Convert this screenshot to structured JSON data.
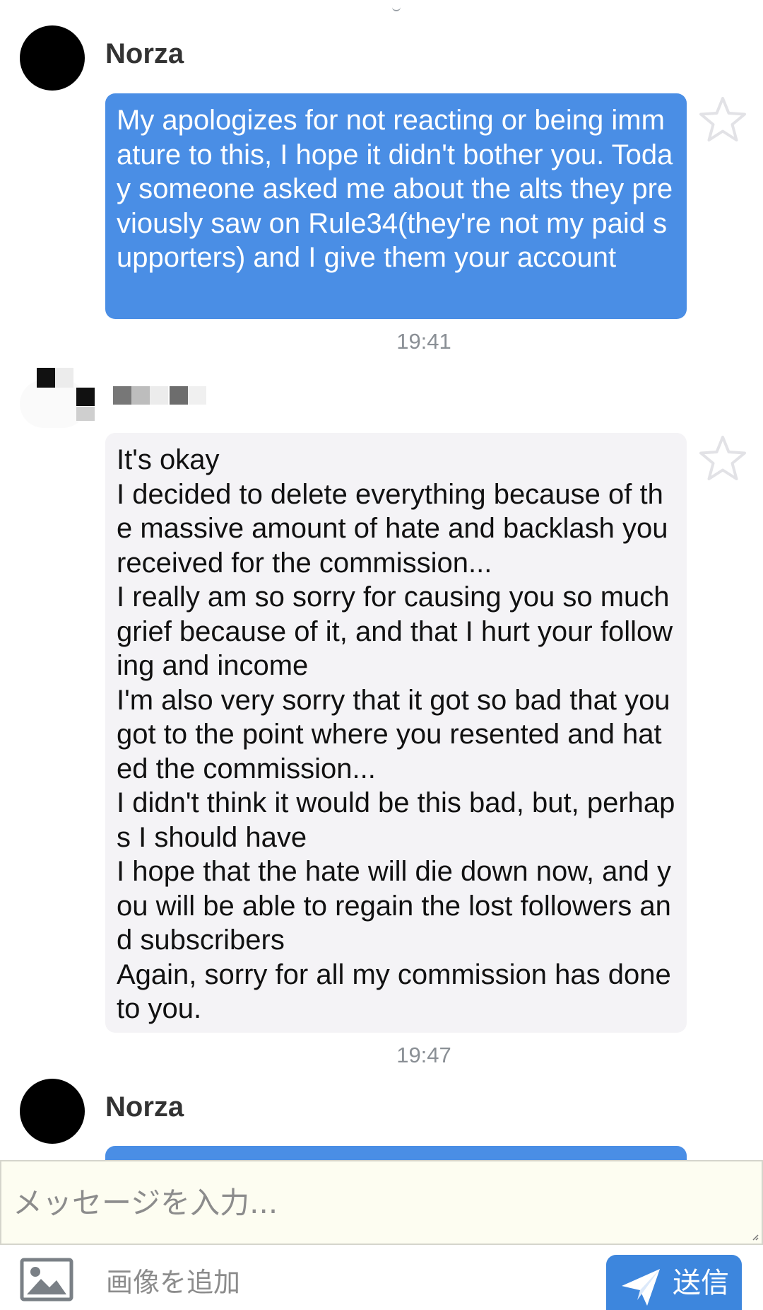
{
  "messages": [
    {
      "sender": "Norza",
      "direction": "sent",
      "text": "My apologizes for not reacting or being immature to this, I hope it didn't bother you. Today someone asked me about the alts they previously saw on Rule34(they're not my paid supporters) and I give them your account",
      "time": "19:41"
    },
    {
      "sender": "",
      "direction": "received",
      "text": "It's okay\nI decided to delete everything because of the massive amount of hate and backlash you received for the commission...\nI really am so sorry for causing you so much grief because of it, and that I hurt your following and income\nI'm also very sorry that it got so bad that you got to the point where you resented and hated the commission...\nI didn't think it would be this bad, but, perhaps I should have\nI hope that the hate will die down now, and you will be able to regain the lost followers and subscribers\nAgain, sorry for all my commission has done to you.",
      "time": "19:47"
    },
    {
      "sender": "Norza",
      "direction": "sent",
      "text": ""
    }
  ],
  "composer": {
    "placeholder": "メッセージを入力...",
    "value": "",
    "add_image_label": "画像を追加",
    "send_label": "送信"
  },
  "icons": {
    "favorite": "star-outline-icon",
    "add_image": "image-icon",
    "send": "paper-plane-icon"
  },
  "colors": {
    "sent_bubble": "#4a8ee5",
    "received_bubble": "#f4f3f6",
    "send_button": "#3d86dd",
    "composer_bg": "#fdfdf1"
  }
}
